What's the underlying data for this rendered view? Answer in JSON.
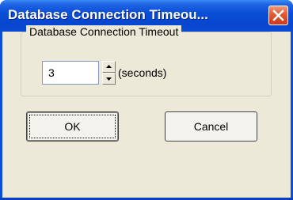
{
  "window": {
    "title": "Database Connection Timeou...",
    "close_icon": "close-x-icon"
  },
  "group": {
    "label": "Database Connection Timeout"
  },
  "timeout": {
    "value": "3",
    "units": "(seconds)",
    "spin_up_icon": "arrow-up-icon",
    "spin_down_icon": "arrow-down-icon"
  },
  "buttons": {
    "ok_label": "OK",
    "cancel_label": "Cancel"
  },
  "colors": {
    "titlebar": "#0a4fd6",
    "close_button": "#e05a32",
    "dialog_background": "#ece9d8"
  }
}
